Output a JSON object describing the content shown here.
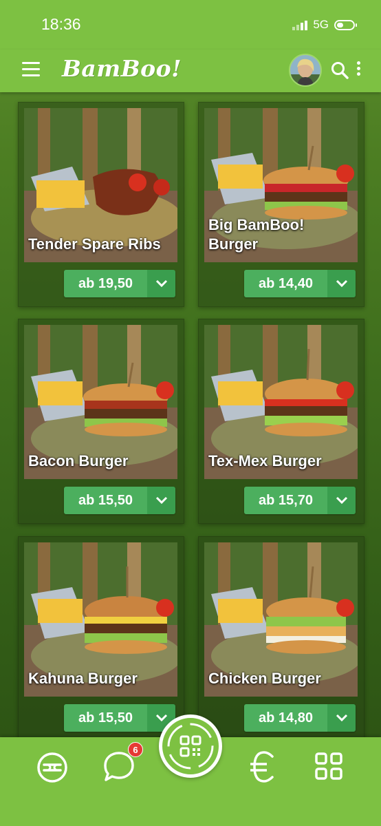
{
  "status": {
    "time": "18:36",
    "network": "5G"
  },
  "header": {
    "logo": "BamBoo!",
    "menu_icon": "hamburger-menu-icon",
    "search_icon": "search-icon",
    "more_icon": "more-vertical-icon"
  },
  "items": [
    {
      "name": "Tender Spare Ribs",
      "price": "ab 19,50"
    },
    {
      "name": "Big BamBoo! Burger",
      "price": "ab 14,40"
    },
    {
      "name": "Bacon Burger",
      "price": "ab 15,50"
    },
    {
      "name": "Tex-Mex Burger",
      "price": "ab 15,70"
    },
    {
      "name": "Kahuna Burger",
      "price": "ab 15,50"
    },
    {
      "name": "Chicken Burger",
      "price": "ab 14,80"
    }
  ],
  "bottom_nav": {
    "items": [
      "fork-knife-icon",
      "chat-bubble-icon",
      "qr-code-icon",
      "euro-icon",
      "grid-icon"
    ],
    "chat_badge": "6"
  },
  "colors": {
    "brand_green": "#7dc142",
    "price_green": "#4caf5e",
    "badge_red": "#e53935"
  }
}
